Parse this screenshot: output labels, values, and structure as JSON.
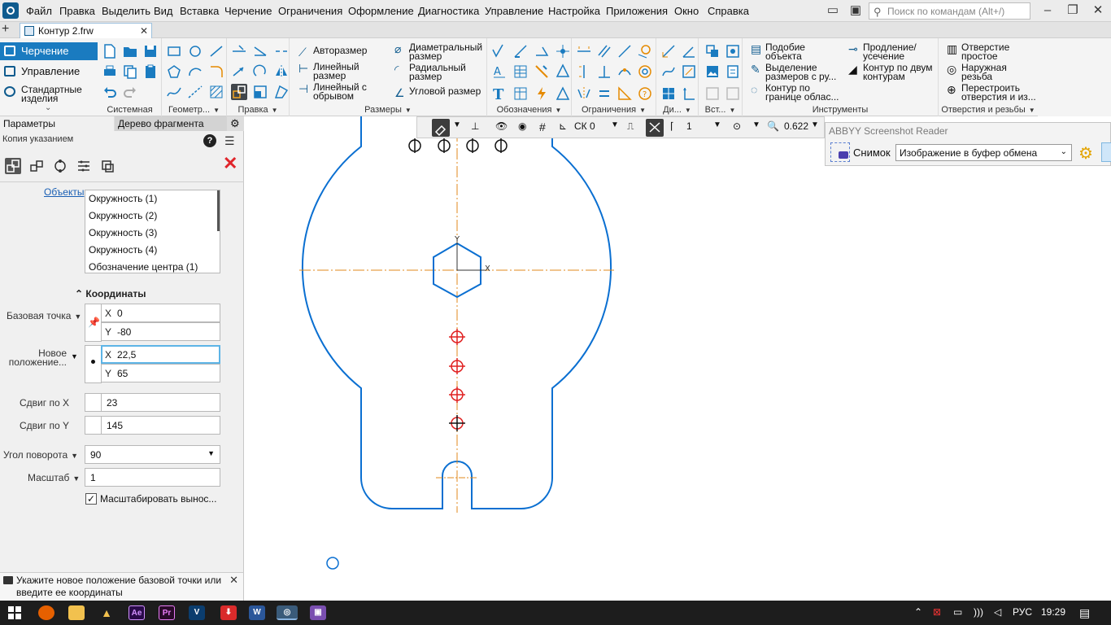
{
  "menubar": {
    "items": [
      "Файл",
      "Правка",
      "Выделить",
      "Вид",
      "Вставка",
      "Черчение",
      "Ограничения",
      "Оформление",
      "Диагностика",
      "Управление",
      "Настройка",
      "Приложения",
      "Окно",
      "Справка"
    ],
    "search_placeholder": "Поиск по командам (Alt+/)"
  },
  "tabs": {
    "document": "Контур 2.frw"
  },
  "ribbon": {
    "nav": [
      "Черчение",
      "Управление",
      "Стандартные изделия"
    ],
    "groups": [
      "Системная",
      "Геометр...",
      "Правка",
      "Размеры",
      "Обозначения",
      "Ограничения",
      "Ди...",
      "Вст...",
      "Инструменты",
      "Отверстия и резьбы"
    ],
    "dimensions": {
      "auto": "Авторазмер",
      "linear": "Линейный размер",
      "linear_break": "Линейный с обрывом",
      "diameter": "Диаметральный размер",
      "radial": "Радиальный размер",
      "angular": "Угловой размер"
    },
    "tools": {
      "similar": "Подобие объекта",
      "select_dims": "Выделение размеров с ру...",
      "contour_boundary": "Контур по границе облас...",
      "extend_trim": "Продление/ усечение",
      "contour_two": "Контур по двум контурам"
    },
    "holes": {
      "simple": "Отверстие простое",
      "outer_thread": "Наружная резьба",
      "rebuild": "Перестроить отверстия и из..."
    }
  },
  "panel": {
    "tab_params": "Параметры",
    "tab_tree": "Дерево фрагмента",
    "command": "Копия указанием",
    "objects_label": "Объекты",
    "objects": [
      "Окружность (1)",
      "Окружность (2)",
      "Окружность (3)",
      "Окружность (4)",
      "Обозначение центра (1)"
    ],
    "coords_header": "Координаты",
    "base_point_label": "Базовая точка",
    "base_x": "0",
    "base_y": "-80",
    "new_pos_label_1": "Новое",
    "new_pos_label_2": "положение...",
    "new_x": "22,5",
    "new_y": "65",
    "shift_x_label": "Сдвиг по X",
    "shift_x": "23",
    "shift_y_label": "Сдвиг по Y",
    "shift_y": "145",
    "angle_label": "Угол поворота",
    "angle": "90",
    "scale_label": "Масштаб",
    "scale": "1",
    "scale_leaders": "Масштабировать вынос...",
    "axis_x": "X",
    "axis_y": "Y"
  },
  "hint": "Укажите новое положение базовой точки или введите ее координаты",
  "viewbar": {
    "cs": "СК 0",
    "layer": "1",
    "zoom": "0.622"
  },
  "abbyy": {
    "title": "ABBYY Screenshot Reader",
    "snapshot_label": "Снимок",
    "target": "Изображение в буфер обмена"
  },
  "taskbar": {
    "lang": "РУС",
    "time": "19:29"
  },
  "colors": {
    "accent": "#1a7bc0",
    "contour": "#0a6fd1",
    "axis": "#e08a1e",
    "marker": "#e02020"
  }
}
